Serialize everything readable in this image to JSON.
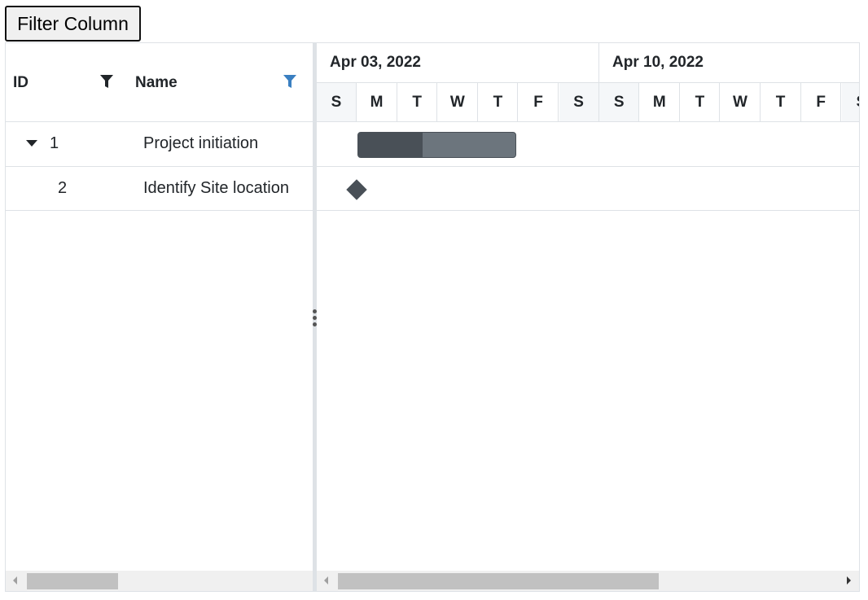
{
  "toolbar": {
    "filter_button_label": "Filter Column"
  },
  "grid": {
    "columns": [
      {
        "label": "ID",
        "filter_icon": "filter-icon",
        "filter_active": false
      },
      {
        "label": "Name",
        "filter_icon": "filter-icon",
        "filter_active": true
      }
    ],
    "rows": [
      {
        "id": "1",
        "name": "Project initiation",
        "expandable": true,
        "expanded": true
      },
      {
        "id": "2",
        "name": "Identify Site location",
        "expandable": false
      }
    ],
    "scroll_position": 0.0
  },
  "timeline": {
    "weeks": [
      "Apr 03, 2022",
      "Apr 10, 2022"
    ],
    "days": [
      "S",
      "M",
      "T",
      "W",
      "T",
      "F",
      "S",
      "S",
      "M",
      "T",
      "W",
      "T",
      "F",
      "S"
    ],
    "scroll_position": 0.0
  },
  "tasks": [
    {
      "id": "1",
      "type": "summary",
      "progress": 0.41
    },
    {
      "id": "2",
      "type": "milestone"
    }
  ],
  "colors": {
    "active_filter": "#3a7fc1",
    "bar": "#6c757d",
    "progress": "#495057",
    "milestone": "#495057"
  }
}
